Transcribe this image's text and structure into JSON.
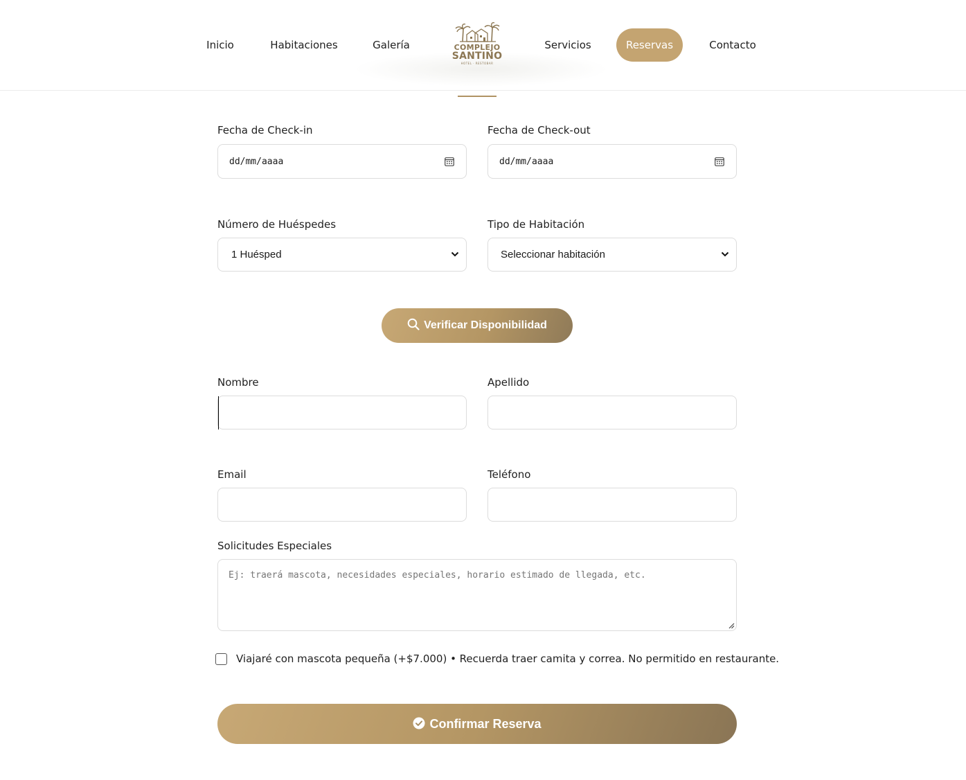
{
  "nav": {
    "items": [
      {
        "label": "Inicio"
      },
      {
        "label": "Habitaciones"
      },
      {
        "label": "Galería"
      },
      {
        "label": "Servicios"
      },
      {
        "label": "Reservas",
        "active": true
      },
      {
        "label": "Contacto"
      }
    ],
    "logo": {
      "line1": "COMPLEJO",
      "line2": "SANTINO",
      "line3": "HOTEL · RESTOBAR"
    }
  },
  "form": {
    "checkin": {
      "label": "Fecha de Check-in",
      "placeholder": "dd/mm/aaaa",
      "icon": "calendar-icon"
    },
    "checkout": {
      "label": "Fecha de Check-out",
      "placeholder": "dd/mm/aaaa",
      "icon": "calendar-icon"
    },
    "guests": {
      "label": "Número de Huéspedes",
      "selected": "1 Huésped"
    },
    "room_type": {
      "label": "Tipo de Habitación",
      "selected": "Seleccionar habitación"
    },
    "verify_button": {
      "label": "Verificar Disponibilidad",
      "icon": "search-icon"
    },
    "first_name": {
      "label": "Nombre",
      "value": ""
    },
    "last_name": {
      "label": "Apellido",
      "value": ""
    },
    "email": {
      "label": "Email",
      "value": ""
    },
    "phone": {
      "label": "Teléfono",
      "value": ""
    },
    "special_requests": {
      "label": "Solicitudes Especiales",
      "placeholder": "Ej: traerá mascota, necesidades especiales, horario estimado de llegada, etc."
    },
    "pet_checkbox": {
      "label": "Viajaré con mascota pequeña (+$7.000) • Recuerda traer camita y correa. No permitido en restaurante.",
      "checked": false
    },
    "confirm_button": {
      "label": "Confirmar Reserva",
      "icon": "check-circle-icon"
    }
  },
  "colors": {
    "accent": "#c4a471",
    "accent_dark": "#8a7555",
    "border": "#dcdcdc"
  }
}
